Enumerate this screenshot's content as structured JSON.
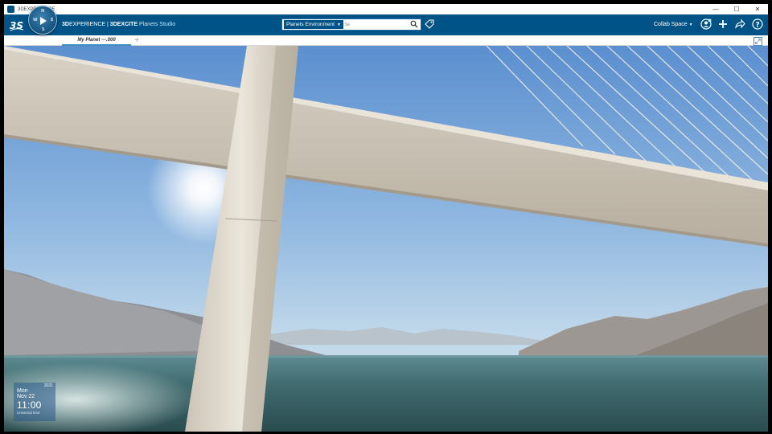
{
  "window": {
    "title": "3DEXPERIENCE",
    "buttons": {
      "minimize": "—",
      "maximize": "☐",
      "close": "✕"
    }
  },
  "topbar": {
    "brand_bold": "3D",
    "brand_rest": "EXPERIENCE | ",
    "brand_app_bold": "3DEXCITE",
    "brand_app": " Planets Studio",
    "search": {
      "scope": "Planets Environment",
      "placeholder": "Se"
    },
    "collab_space": "Collab Space"
  },
  "tabs": [
    {
      "label": "My Planet ---.000",
      "active": true
    }
  ],
  "clock": {
    "year": "2021",
    "day": "Mon",
    "date": "Nov 22",
    "time": "11:00",
    "timezone": "Universal time"
  },
  "colors": {
    "topbar": "#005386",
    "sky_top": "#5b8fcf",
    "water": "#3f6a6e"
  },
  "icons": {
    "logo": "ds-logo-icon",
    "compass": "compass-icon",
    "search": "search-icon",
    "tag": "tag-icon",
    "user": "user-icon",
    "add": "plus-icon",
    "share": "share-icon",
    "help": "help-icon",
    "expand": "expand-icon"
  }
}
